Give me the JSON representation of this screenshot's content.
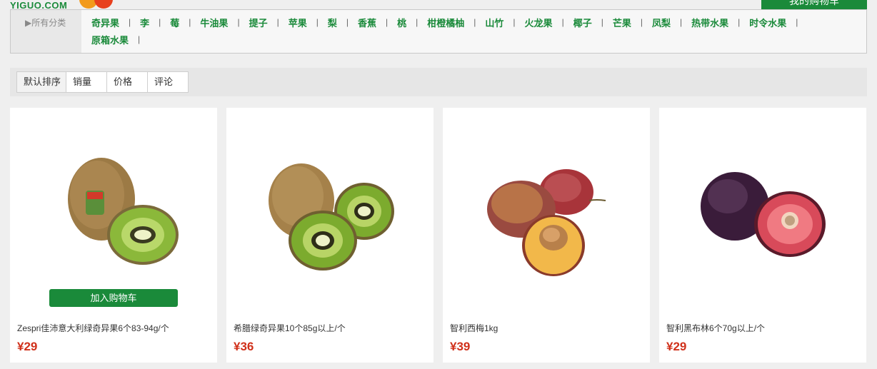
{
  "header": {
    "logo_text": "YIGUO.COM",
    "cart_label": "我的购物车"
  },
  "categories": {
    "all_label": "▶所有分类",
    "separator": "|",
    "items": [
      "奇异果",
      "李",
      "莓",
      "牛油果",
      "提子",
      "苹果",
      "梨",
      "香蕉",
      "桃",
      "柑橙橘柚",
      "山竹",
      "火龙果",
      "椰子",
      "芒果",
      "凤梨",
      "热带水果",
      "时令水果",
      "原箱水果"
    ]
  },
  "sort": {
    "tabs": [
      "默认排序",
      "销量",
      "价格",
      "评论"
    ]
  },
  "products": [
    {
      "name": "Zespri佳沛意大利绿奇异果6个83-94g/个",
      "price": "¥29",
      "add_label": "加入购物车",
      "image": "kiwi-zespri"
    },
    {
      "name": "希腊绿奇异果10个85g以上/个",
      "price": "¥36",
      "image": "kiwi-greek"
    },
    {
      "name": "智利西梅1kg",
      "price": "¥39",
      "image": "prune"
    },
    {
      "name": "智利黑布林6个70g以上/个",
      "price": "¥29",
      "image": "black-plum"
    }
  ],
  "colors": {
    "brand_green": "#1a8a3a",
    "price_red": "#d0301a",
    "logo_orange": "#f29a1c",
    "logo_red": "#e8401d"
  }
}
